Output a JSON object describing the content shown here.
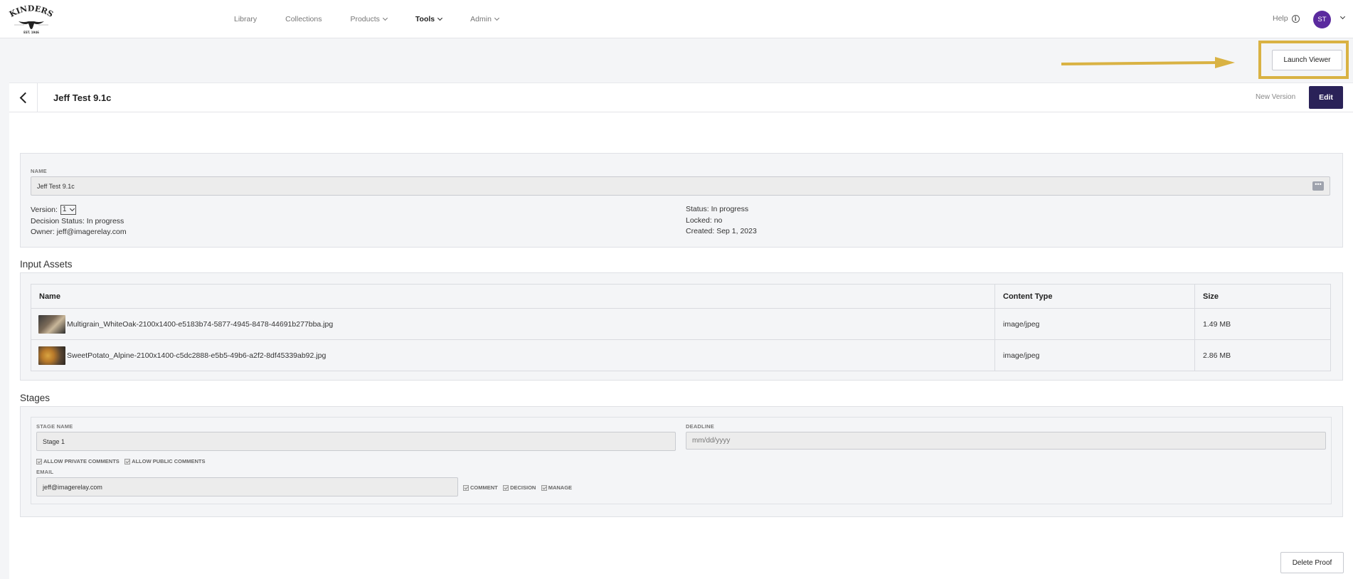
{
  "nav": {
    "logo_text": "KINDERS",
    "logo_subtext": "EST. 1946",
    "items": [
      {
        "label": "Library"
      },
      {
        "label": "Collections"
      },
      {
        "label": "Products"
      },
      {
        "label": "Tools"
      },
      {
        "label": "Admin"
      }
    ],
    "help_label": "Help",
    "avatar_initials": "ST"
  },
  "toolbar": {
    "launch_viewer_label": "Launch Viewer",
    "highlight_color": "#d9b243"
  },
  "header": {
    "title": "Jeff Test 9.1c",
    "new_version_label": "New Version",
    "edit_label": "Edit"
  },
  "details": {
    "name_label": "NAME",
    "name_value": "Jeff Test 9.1c",
    "version_label": "Version:",
    "version_value": "1",
    "decision_status": "Decision Status: In progress",
    "owner": "Owner: jeff@imagerelay.com",
    "status": "Status: In progress",
    "locked": "Locked: no",
    "created": "Created: Sep 1, 2023"
  },
  "input_assets": {
    "title": "Input Assets",
    "columns": [
      "Name",
      "Content Type",
      "Size"
    ],
    "rows": [
      {
        "name": "Multigrain_WhiteOak-2100x1400-e5183b74-5877-4945-8478-44691b277bba.jpg",
        "content_type": "image/jpeg",
        "size": "1.49 MB"
      },
      {
        "name": "SweetPotato_Alpine-2100x1400-c5dc2888-e5b5-49b6-a2f2-8df45339ab92.jpg",
        "content_type": "image/jpeg",
        "size": "2.86 MB"
      }
    ]
  },
  "stages": {
    "title": "Stages",
    "stage_name_label": "STAGE NAME",
    "stage_name_value": "Stage 1",
    "deadline_label": "DEADLINE",
    "deadline_placeholder": "mm/dd/yyyy",
    "allow_private_label": "ALLOW PRIVATE COMMENTS",
    "allow_public_label": "ALLOW PUBLIC COMMENTS",
    "email_label": "EMAIL",
    "email_value": "jeff@imagerelay.com",
    "comment_label": "COMMENT",
    "decision_label": "DECISION",
    "manage_label": "MANAGE"
  },
  "footer": {
    "delete_label": "Delete Proof"
  },
  "colors": {
    "primary": "#2a2258",
    "avatar": "#5b2a9e",
    "highlight": "#d9b243"
  }
}
